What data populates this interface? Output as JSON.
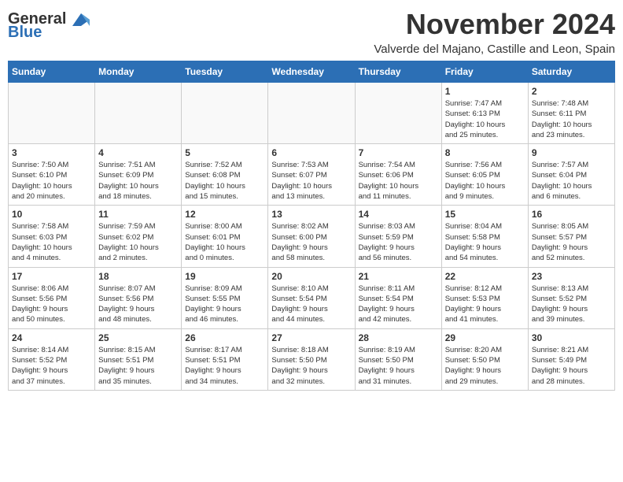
{
  "header": {
    "logo_general": "General",
    "logo_blue": "Blue",
    "month": "November 2024",
    "location": "Valverde del Majano, Castille and Leon, Spain"
  },
  "days_of_week": [
    "Sunday",
    "Monday",
    "Tuesday",
    "Wednesday",
    "Thursday",
    "Friday",
    "Saturday"
  ],
  "weeks": [
    [
      {
        "day": "",
        "info": ""
      },
      {
        "day": "",
        "info": ""
      },
      {
        "day": "",
        "info": ""
      },
      {
        "day": "",
        "info": ""
      },
      {
        "day": "",
        "info": ""
      },
      {
        "day": "1",
        "info": "Sunrise: 7:47 AM\nSunset: 6:13 PM\nDaylight: 10 hours\nand 25 minutes."
      },
      {
        "day": "2",
        "info": "Sunrise: 7:48 AM\nSunset: 6:11 PM\nDaylight: 10 hours\nand 23 minutes."
      }
    ],
    [
      {
        "day": "3",
        "info": "Sunrise: 7:50 AM\nSunset: 6:10 PM\nDaylight: 10 hours\nand 20 minutes."
      },
      {
        "day": "4",
        "info": "Sunrise: 7:51 AM\nSunset: 6:09 PM\nDaylight: 10 hours\nand 18 minutes."
      },
      {
        "day": "5",
        "info": "Sunrise: 7:52 AM\nSunset: 6:08 PM\nDaylight: 10 hours\nand 15 minutes."
      },
      {
        "day": "6",
        "info": "Sunrise: 7:53 AM\nSunset: 6:07 PM\nDaylight: 10 hours\nand 13 minutes."
      },
      {
        "day": "7",
        "info": "Sunrise: 7:54 AM\nSunset: 6:06 PM\nDaylight: 10 hours\nand 11 minutes."
      },
      {
        "day": "8",
        "info": "Sunrise: 7:56 AM\nSunset: 6:05 PM\nDaylight: 10 hours\nand 9 minutes."
      },
      {
        "day": "9",
        "info": "Sunrise: 7:57 AM\nSunset: 6:04 PM\nDaylight: 10 hours\nand 6 minutes."
      }
    ],
    [
      {
        "day": "10",
        "info": "Sunrise: 7:58 AM\nSunset: 6:03 PM\nDaylight: 10 hours\nand 4 minutes."
      },
      {
        "day": "11",
        "info": "Sunrise: 7:59 AM\nSunset: 6:02 PM\nDaylight: 10 hours\nand 2 minutes."
      },
      {
        "day": "12",
        "info": "Sunrise: 8:00 AM\nSunset: 6:01 PM\nDaylight: 10 hours\nand 0 minutes."
      },
      {
        "day": "13",
        "info": "Sunrise: 8:02 AM\nSunset: 6:00 PM\nDaylight: 9 hours\nand 58 minutes."
      },
      {
        "day": "14",
        "info": "Sunrise: 8:03 AM\nSunset: 5:59 PM\nDaylight: 9 hours\nand 56 minutes."
      },
      {
        "day": "15",
        "info": "Sunrise: 8:04 AM\nSunset: 5:58 PM\nDaylight: 9 hours\nand 54 minutes."
      },
      {
        "day": "16",
        "info": "Sunrise: 8:05 AM\nSunset: 5:57 PM\nDaylight: 9 hours\nand 52 minutes."
      }
    ],
    [
      {
        "day": "17",
        "info": "Sunrise: 8:06 AM\nSunset: 5:56 PM\nDaylight: 9 hours\nand 50 minutes."
      },
      {
        "day": "18",
        "info": "Sunrise: 8:07 AM\nSunset: 5:56 PM\nDaylight: 9 hours\nand 48 minutes."
      },
      {
        "day": "19",
        "info": "Sunrise: 8:09 AM\nSunset: 5:55 PM\nDaylight: 9 hours\nand 46 minutes."
      },
      {
        "day": "20",
        "info": "Sunrise: 8:10 AM\nSunset: 5:54 PM\nDaylight: 9 hours\nand 44 minutes."
      },
      {
        "day": "21",
        "info": "Sunrise: 8:11 AM\nSunset: 5:54 PM\nDaylight: 9 hours\nand 42 minutes."
      },
      {
        "day": "22",
        "info": "Sunrise: 8:12 AM\nSunset: 5:53 PM\nDaylight: 9 hours\nand 41 minutes."
      },
      {
        "day": "23",
        "info": "Sunrise: 8:13 AM\nSunset: 5:52 PM\nDaylight: 9 hours\nand 39 minutes."
      }
    ],
    [
      {
        "day": "24",
        "info": "Sunrise: 8:14 AM\nSunset: 5:52 PM\nDaylight: 9 hours\nand 37 minutes."
      },
      {
        "day": "25",
        "info": "Sunrise: 8:15 AM\nSunset: 5:51 PM\nDaylight: 9 hours\nand 35 minutes."
      },
      {
        "day": "26",
        "info": "Sunrise: 8:17 AM\nSunset: 5:51 PM\nDaylight: 9 hours\nand 34 minutes."
      },
      {
        "day": "27",
        "info": "Sunrise: 8:18 AM\nSunset: 5:50 PM\nDaylight: 9 hours\nand 32 minutes."
      },
      {
        "day": "28",
        "info": "Sunrise: 8:19 AM\nSunset: 5:50 PM\nDaylight: 9 hours\nand 31 minutes."
      },
      {
        "day": "29",
        "info": "Sunrise: 8:20 AM\nSunset: 5:50 PM\nDaylight: 9 hours\nand 29 minutes."
      },
      {
        "day": "30",
        "info": "Sunrise: 8:21 AM\nSunset: 5:49 PM\nDaylight: 9 hours\nand 28 minutes."
      }
    ]
  ]
}
